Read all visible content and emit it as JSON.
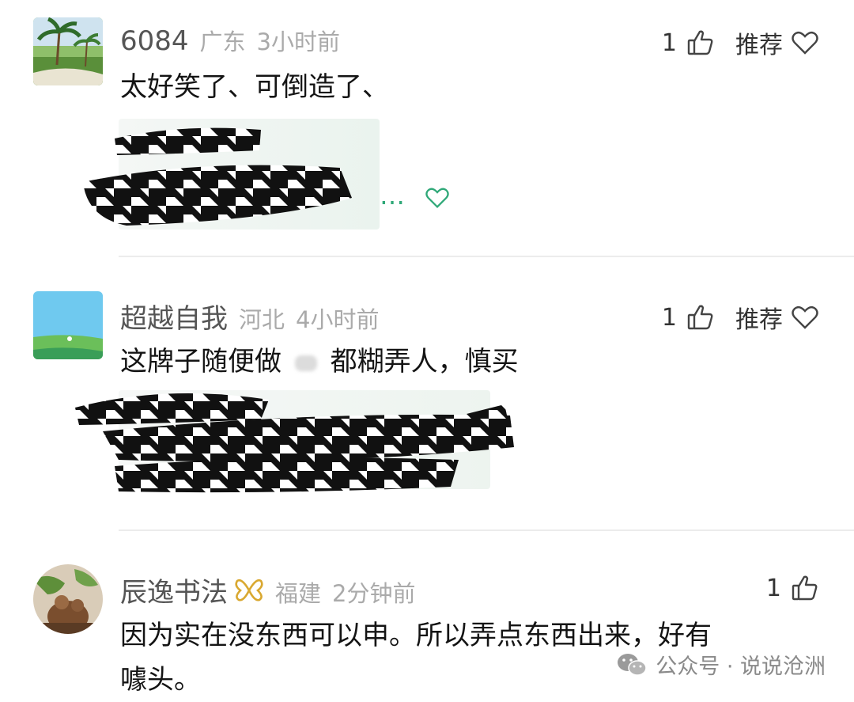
{
  "comments": [
    {
      "username": "6084",
      "location": "广东",
      "time": "3小时前",
      "text": "太好笑了、可倒造了、",
      "likes": "1",
      "recommend_label": "推荐",
      "image_tail": "…"
    },
    {
      "username": "超越自我",
      "location": "河北",
      "time": "4小时前",
      "text_part1": "这牌子随便做",
      "text_part2": "都糊弄人，慎买",
      "likes": "1",
      "recommend_label": "推荐"
    },
    {
      "username": "辰逸书法",
      "badge_icon": "butterfly-icon",
      "location": "福建",
      "time": "2分钟前",
      "text_line1": "因为实在没东西可以申。所以弄点东西出来，好有",
      "text_line2": "噱头。",
      "likes": "1"
    }
  ],
  "watermark": {
    "label": "公众号 · 说说沧洲",
    "icon": "wechat-icon"
  },
  "colors": {
    "accent_green": "#2fa878",
    "meta_gray": "#aaaaaa",
    "divider": "#ececec"
  }
}
